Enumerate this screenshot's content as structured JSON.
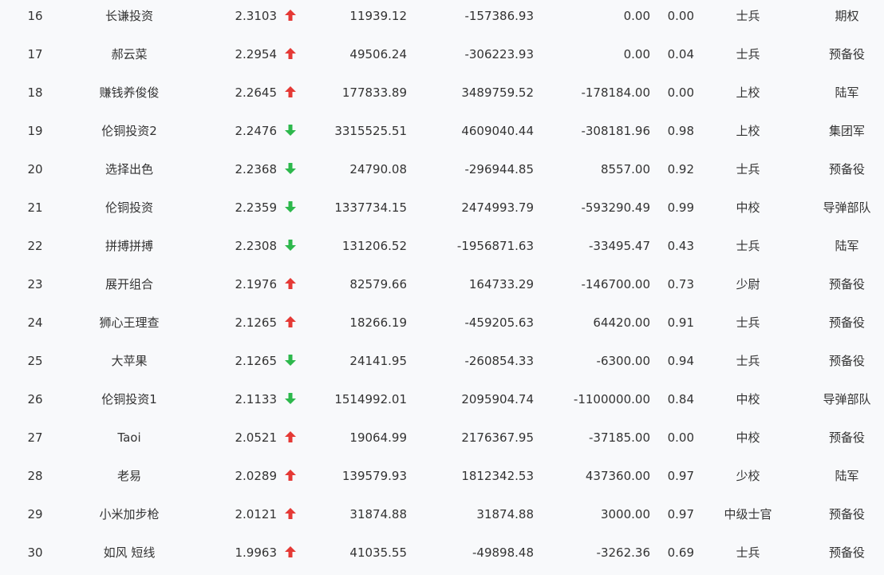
{
  "colors": {
    "up_arrow": "#e53935",
    "down_arrow": "#2db84c",
    "text": "#333333",
    "background": "#f8f9fb"
  },
  "rows": [
    {
      "rank": "16",
      "name": "长谦投资",
      "value": "2.3103",
      "trend": "up",
      "amount": "11939.12",
      "pnl": "-157386.93",
      "position": "0.00",
      "ratio": "0.00",
      "level": "士兵",
      "type": "期权"
    },
    {
      "rank": "17",
      "name": "郝云菜",
      "value": "2.2954",
      "trend": "up",
      "amount": "49506.24",
      "pnl": "-306223.93",
      "position": "0.00",
      "ratio": "0.04",
      "level": "士兵",
      "type": "预备役"
    },
    {
      "rank": "18",
      "name": "赚钱养俊俊",
      "value": "2.2645",
      "trend": "up",
      "amount": "177833.89",
      "pnl": "3489759.52",
      "position": "-178184.00",
      "ratio": "0.00",
      "level": "上校",
      "type": "陆军"
    },
    {
      "rank": "19",
      "name": "伦铜投资2",
      "value": "2.2476",
      "trend": "down",
      "amount": "3315525.51",
      "pnl": "4609040.44",
      "position": "-308181.96",
      "ratio": "0.98",
      "level": "上校",
      "type": "集团军"
    },
    {
      "rank": "20",
      "name": "选择出色",
      "value": "2.2368",
      "trend": "down",
      "amount": "24790.08",
      "pnl": "-296944.85",
      "position": "8557.00",
      "ratio": "0.92",
      "level": "士兵",
      "type": "预备役"
    },
    {
      "rank": "21",
      "name": "伦铜投资",
      "value": "2.2359",
      "trend": "down",
      "amount": "1337734.15",
      "pnl": "2474993.79",
      "position": "-593290.49",
      "ratio": "0.99",
      "level": "中校",
      "type": "导弹部队"
    },
    {
      "rank": "22",
      "name": "拼搏拼搏",
      "value": "2.2308",
      "trend": "down",
      "amount": "131206.52",
      "pnl": "-1956871.63",
      "position": "-33495.47",
      "ratio": "0.43",
      "level": "士兵",
      "type": "陆军"
    },
    {
      "rank": "23",
      "name": "展开组合",
      "value": "2.1976",
      "trend": "up",
      "amount": "82579.66",
      "pnl": "164733.29",
      "position": "-146700.00",
      "ratio": "0.73",
      "level": "少尉",
      "type": "预备役"
    },
    {
      "rank": "24",
      "name": "狮心王理查",
      "value": "2.1265",
      "trend": "up",
      "amount": "18266.19",
      "pnl": "-459205.63",
      "position": "64420.00",
      "ratio": "0.91",
      "level": "士兵",
      "type": "预备役"
    },
    {
      "rank": "25",
      "name": "大苹果",
      "value": "2.1265",
      "trend": "down",
      "amount": "24141.95",
      "pnl": "-260854.33",
      "position": "-6300.00",
      "ratio": "0.94",
      "level": "士兵",
      "type": "预备役"
    },
    {
      "rank": "26",
      "name": "伦铜投资1",
      "value": "2.1133",
      "trend": "down",
      "amount": "1514992.01",
      "pnl": "2095904.74",
      "position": "-1100000.00",
      "ratio": "0.84",
      "level": "中校",
      "type": "导弹部队"
    },
    {
      "rank": "27",
      "name": "Taoi",
      "value": "2.0521",
      "trend": "up",
      "amount": "19064.99",
      "pnl": "2176367.95",
      "position": "-37185.00",
      "ratio": "0.00",
      "level": "中校",
      "type": "预备役"
    },
    {
      "rank": "28",
      "name": "老易",
      "value": "2.0289",
      "trend": "up",
      "amount": "139579.93",
      "pnl": "1812342.53",
      "position": "437360.00",
      "ratio": "0.97",
      "level": "少校",
      "type": "陆军"
    },
    {
      "rank": "29",
      "name": "小米加步枪",
      "value": "2.0121",
      "trend": "up",
      "amount": "31874.88",
      "pnl": "31874.88",
      "position": "3000.00",
      "ratio": "0.97",
      "level": "中级士官",
      "type": "预备役"
    },
    {
      "rank": "30",
      "name": "如风 短线",
      "value": "1.9963",
      "trend": "up",
      "amount": "41035.55",
      "pnl": "-49898.48",
      "position": "-3262.36",
      "ratio": "0.69",
      "level": "士兵",
      "type": "预备役"
    }
  ]
}
